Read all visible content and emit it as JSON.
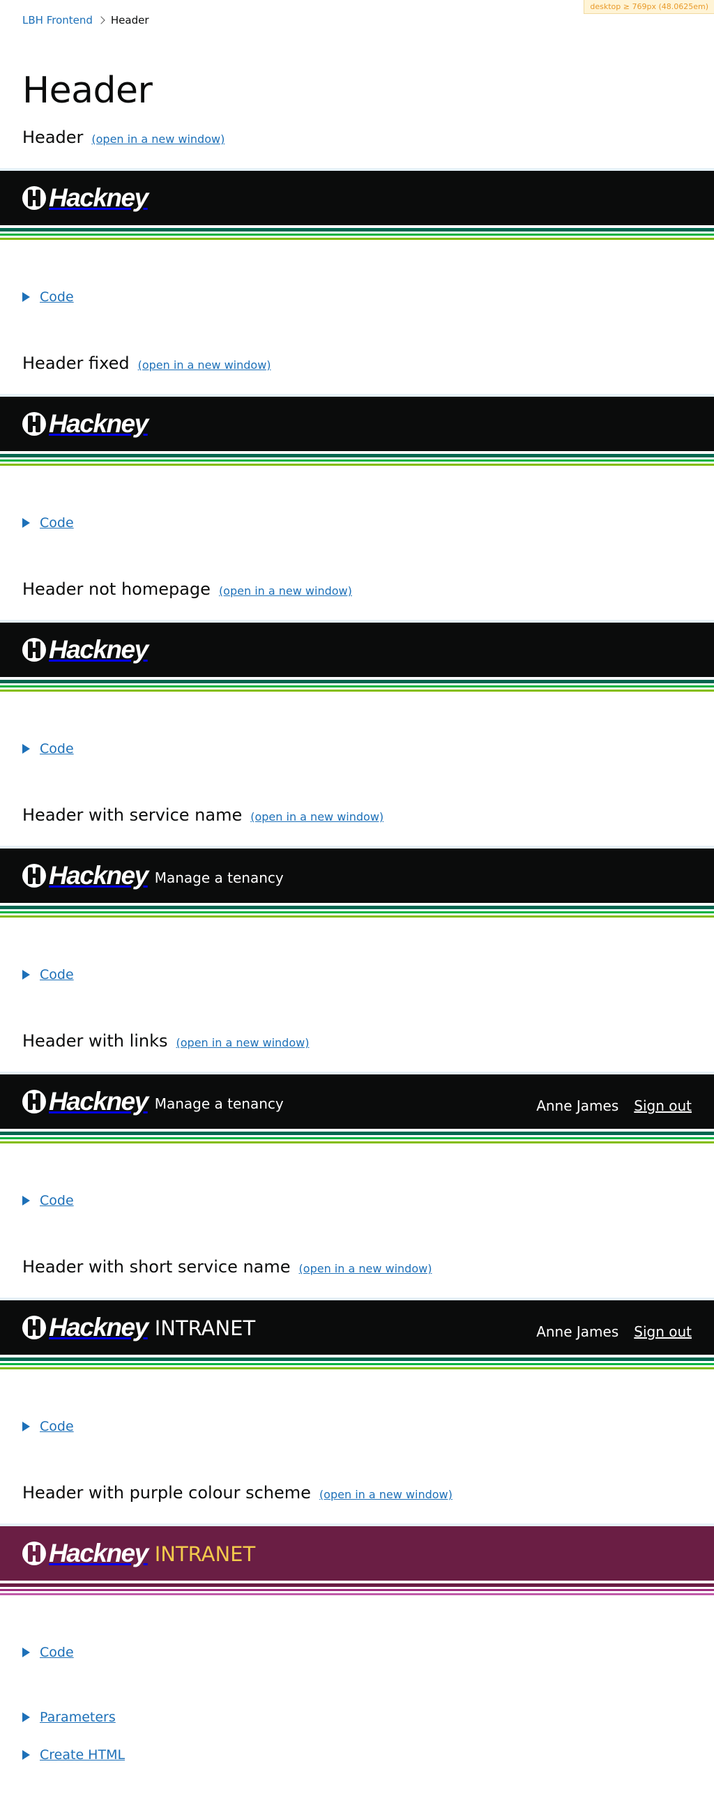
{
  "breakpoint_label": "desktop ≥ 769px (48.0625em)",
  "breadcrumb": {
    "parent": "LBH Frontend",
    "current": "Header"
  },
  "page_title": "Header",
  "logo_text": "Hackney",
  "open_link": "(open in a new window)",
  "code_label": "Code",
  "examples": [
    {
      "title": "Header",
      "service": "",
      "user": "",
      "signout": ""
    },
    {
      "title": "Header fixed",
      "service": "",
      "user": "",
      "signout": ""
    },
    {
      "title": "Header not homepage",
      "service": "",
      "user": "",
      "signout": ""
    },
    {
      "title": "Header with service name",
      "service": "Manage a tenancy",
      "user": "",
      "signout": ""
    },
    {
      "title": "Header with links",
      "service": "Manage a tenancy",
      "user": "Anne James",
      "signout": "Sign out"
    },
    {
      "title": "Header with short service name",
      "service": "INTRANET",
      "user": "Anne James",
      "signout": "Sign out"
    },
    {
      "title": "Header with purple colour scheme",
      "service": "INTRANET",
      "user": "",
      "signout": ""
    }
  ],
  "parameters_label": "Parameters",
  "create_html_label": "Create HTML",
  "colors": {
    "link": "#1d70b8",
    "header_black": "#0b0c0c",
    "header_purple": "#6a1e44",
    "stripe_dark_green": "#00664f",
    "stripe_green": "#00b341",
    "stripe_light_green": "#84bd00",
    "intranet_yellow": "#f2c94c"
  }
}
